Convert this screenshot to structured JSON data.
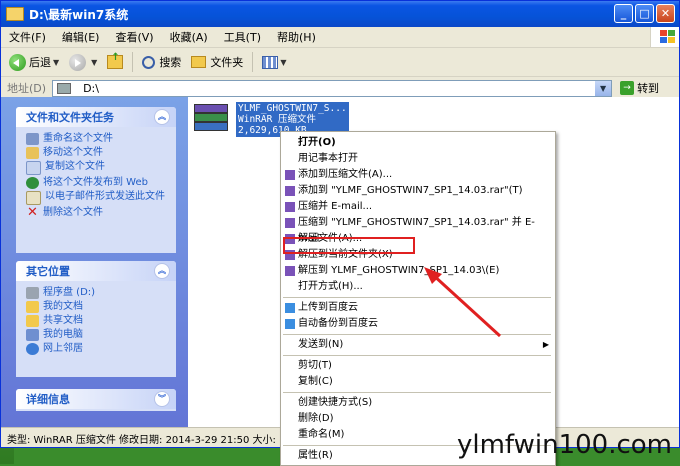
{
  "window": {
    "title": "D:\\最新win7系统"
  },
  "menubar": [
    "文件(F)",
    "编辑(E)",
    "查看(V)",
    "收藏(A)",
    "工具(T)",
    "帮助(H)"
  ],
  "toolbar": {
    "back": "后退",
    "search": "搜索",
    "folders": "文件夹"
  },
  "address": {
    "label": "地址(D)",
    "value": "D:\\",
    "go": "转到"
  },
  "tasks": {
    "title": "文件和文件夹任务",
    "items": [
      "重命名这个文件",
      "移动这个文件",
      "复制这个文件",
      "将这个文件发布到 Web",
      "以电子邮件形式发送此文件",
      "删除这个文件"
    ]
  },
  "other": {
    "title": "其它位置",
    "items": [
      "程序盘 (D:)",
      "我的文档",
      "共享文档",
      "我的电脑",
      "网上邻居"
    ]
  },
  "details": {
    "title": "详细信息"
  },
  "file": {
    "name": "YLMF_GHOSTWIN7_S...",
    "type": "WinRAR 压缩文件",
    "size": "2,629,610 KB"
  },
  "status": "类型: WinRAR 压缩文件 修改日期: 2014-3-29 21:50 大小:",
  "context_menu": {
    "open": "打开(O)",
    "notepad": "用记事本打开",
    "add_archive": "添加到压缩文件(A)...",
    "add_named": "添加到 \"YLMF_GHOSTWIN7_SP1_14.03.rar\"(T)",
    "compress_email": "压缩并 E-mail...",
    "compress_named_email": "压缩到 \"YLMF_GHOSTWIN7_SP1_14.03.rar\" 并 E-mail",
    "extract_files": "解压文件(A)...",
    "extract_here": "解压到当前文件夹(X)",
    "extract_to": "解压到 YLMF_GHOSTWIN7_SP1_14.03\\(E)",
    "open_with": "打开方式(H)...",
    "upload_baidu": "上传到百度云",
    "auto_backup_baidu": "自动备份到百度云",
    "send_to": "发送到(N)",
    "cut": "剪切(T)",
    "copy": "复制(C)",
    "create_shortcut": "创建快捷方式(S)",
    "delete": "删除(D)",
    "rename": "重命名(M)",
    "properties": "属性(R)"
  },
  "watermark": "ylmfwin100.com",
  "colors": {
    "highlight_box": "#e02020",
    "arrow": "#e02020",
    "selection": "#316ac5"
  }
}
